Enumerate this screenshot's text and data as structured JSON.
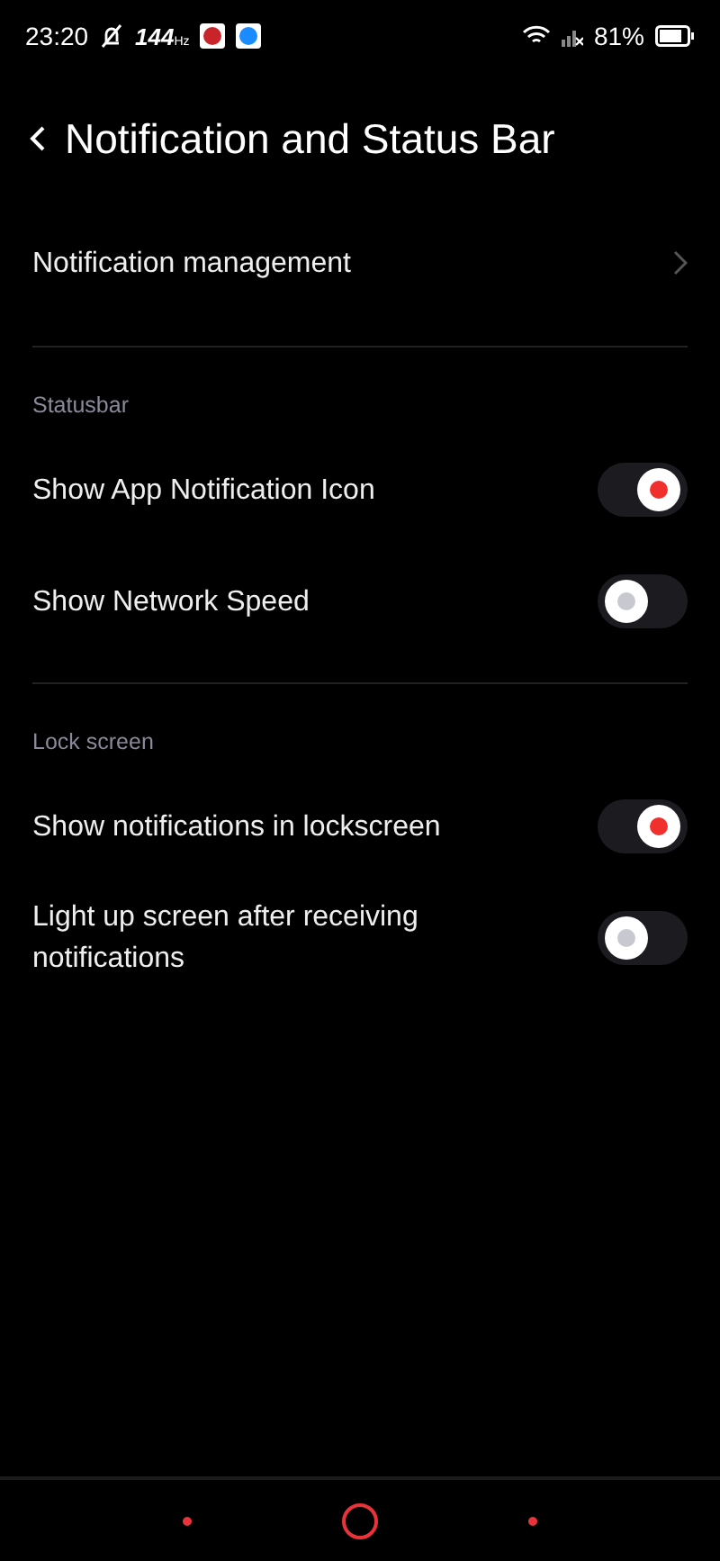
{
  "status_bar": {
    "time": "23:20",
    "refresh_rate": "144",
    "refresh_unit": "Hz",
    "battery": "81%"
  },
  "header": {
    "title": "Notification and Status Bar"
  },
  "top_items": [
    {
      "label": "Notification management"
    }
  ],
  "sections": [
    {
      "title": "Statusbar",
      "rows": [
        {
          "label": "Show App Notification Icon",
          "on": true
        },
        {
          "label": "Show Network Speed",
          "on": false
        }
      ]
    },
    {
      "title": "Lock screen",
      "rows": [
        {
          "label": "Show notifications in lockscreen",
          "on": true
        },
        {
          "label": "Light up screen after receiving notifications",
          "on": false
        }
      ]
    }
  ]
}
